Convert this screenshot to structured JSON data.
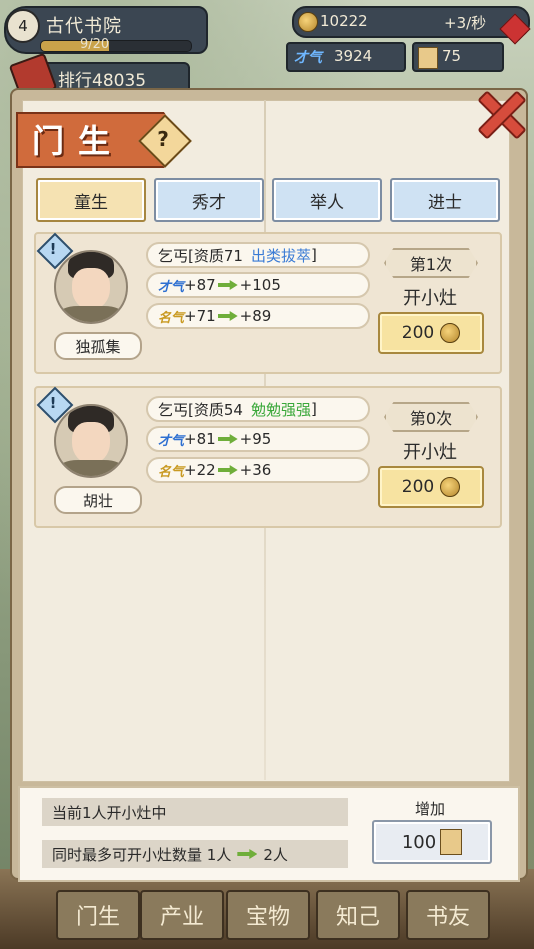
{
  "hud": {
    "level": "4",
    "academy_name": "古代书院",
    "progress_text": "9/20",
    "progress_fraction": 0.45,
    "rank_label": "排行",
    "rank_value": "48035",
    "coins": "10222",
    "coin_rate": "+3/秒",
    "talent_label": "才气",
    "talent_value": "3924",
    "books": "75"
  },
  "panel": {
    "title": "门生",
    "tabs": [
      {
        "label": "童生",
        "active": true
      },
      {
        "label": "秀才",
        "active": false
      },
      {
        "label": "举人",
        "active": false
      },
      {
        "label": "进士",
        "active": false
      }
    ]
  },
  "students": [
    {
      "name": "独孤集",
      "identity": "乞丐[资质71",
      "grade": "出类拔萃",
      "grade_suffix": "]",
      "grade_color": "#3a7bd5",
      "talent_from": "+87",
      "talent_to": "+105",
      "fame_from": "+71",
      "fame_to": "+89",
      "count": "第1次",
      "action": "开小灶",
      "cost": "200"
    },
    {
      "name": "胡壮",
      "identity": "乞丐[资质54",
      "grade": "勉勉强强",
      "grade_suffix": "]",
      "grade_color": "#3aa83a",
      "talent_from": "+81",
      "talent_to": "+95",
      "fame_from": "+22",
      "fame_to": "+36",
      "count": "第0次",
      "action": "开小灶",
      "cost": "200"
    }
  ],
  "glyphs": {
    "talent": "才气",
    "fame": "名气"
  },
  "footer": {
    "current_status": "当前1人开小灶中",
    "max_status_prefix": "同时最多可开小灶数量 1人",
    "max_status_next": "2人",
    "add_label": "增加",
    "add_cost": "100"
  },
  "bottom_nav": [
    "门生",
    "产业",
    "宝物",
    "知己",
    "书友"
  ]
}
